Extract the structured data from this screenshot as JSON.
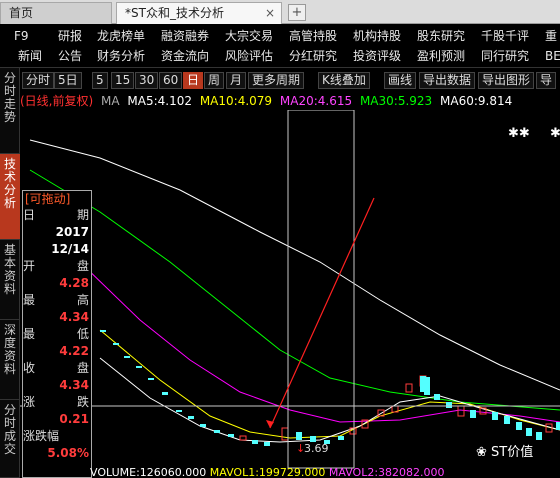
{
  "tabs": {
    "home": "首页",
    "active": "*ST众和_技术分析",
    "close": "×",
    "add": "+"
  },
  "menu": {
    "row1": [
      "F9",
      "研报",
      "龙虎榜单",
      "融资融券",
      "大宗交易",
      "高管持股",
      "机构持股",
      "股东研究",
      "千股千评",
      "重"
    ],
    "row2": [
      "新闻",
      "公告",
      "财务分析",
      "资金流向",
      "风险评估",
      "分红研究",
      "投资评级",
      "盈利预测",
      "同行研究",
      "BE"
    ]
  },
  "left_tabs": [
    "分时走势",
    "技术分析",
    "基本资料",
    "深度资料",
    "分时成交"
  ],
  "toolbar": {
    "items": [
      "分时",
      "5日",
      "5",
      "15",
      "30",
      "60",
      "日",
      "周",
      "月",
      "更多周期",
      "K线叠加",
      "画线",
      "导出数据",
      "导出图形",
      "导"
    ],
    "active": "日"
  },
  "legend": {
    "mode": "(日线,前复权)",
    "ma": "MA",
    "ma5": "MA5:4.102",
    "ma10": "MA10:4.079",
    "ma20": "MA20:4.615",
    "ma30": "MA30:5.923",
    "ma60": "MA60:9.814"
  },
  "info_panel": {
    "header": "[可拖动]",
    "date_label_1": "日",
    "date_label_2": "期",
    "year": "2017",
    "date": "12/14",
    "open_label_1": "开",
    "open_label_2": "盘",
    "open": "4.28",
    "high_label_1": "最",
    "high_label_2": "高",
    "high": "4.34",
    "low_label_1": "最",
    "low_label_2": "低",
    "low": "4.22",
    "close_label_1": "收",
    "close_label_2": "盘",
    "close": "4.34",
    "change_label_1": "涨",
    "change_label_2": "跌",
    "change": "0.21",
    "pct_label": "涨跌幅",
    "pct": "5.08%"
  },
  "chart_data": {
    "type": "candlestick",
    "price_marker": "3.69",
    "markers": [
      "✱✱",
      "✱"
    ],
    "colors": {
      "ma5": "#ffffff",
      "ma10": "#ffff00",
      "ma20": "#ff00ff",
      "ma30": "#00ff00",
      "ma60": "#ffffff",
      "up": "#ff3c3c",
      "down": "#54ffff",
      "crosshair": "#c8c8c8",
      "trend": "#ff2020"
    }
  },
  "volume": {
    "vol": "VOLUME:126060.000",
    "vol1": "MAVOL1:199729.000",
    "vol2": "MAVOL2:382082.000"
  },
  "watermark": "ST价值"
}
